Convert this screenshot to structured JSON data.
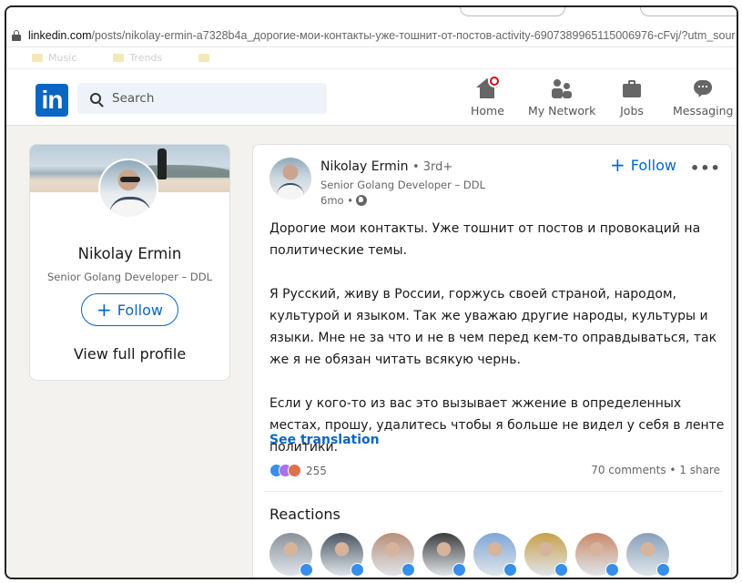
{
  "browser": {
    "url_host": "linkedin.com",
    "url_path": "/posts/nikolay-ermin-a7328b4a_дорогие-мои-контакты-уже-тошнит-от-постов-activity-6907389965115006976-cFvj/?utm_sour",
    "bookmarks": [
      {
        "label": "Music"
      },
      {
        "label": "Trends"
      },
      {
        "label": ""
      },
      {
        "label": ""
      }
    ]
  },
  "header": {
    "logo": "in",
    "search_placeholder": "Search",
    "nav": {
      "home": "Home",
      "network": "My Network",
      "jobs": "Jobs",
      "messaging": "Messaging"
    }
  },
  "profile_card": {
    "name": "Nikolay Ermin",
    "headline": "Senior Golang Developer – DDL",
    "follow_label": "Follow",
    "view_profile": "View full profile"
  },
  "post": {
    "author": "Nikolay Ermin",
    "degree": "• 3rd+",
    "headline": "Senior Golang Developer – DDL",
    "time": "6mo •",
    "follow_label": "Follow",
    "more": "•••",
    "paragraphs": [
      "Дорогие мои контакты. Уже тошнит от постов и провокаций на политические темы.",
      "Я Русский, живу в России, горжусь своей страной, народом, культурой и языком. Так же уважаю другие народы, культуры и языки. Мне не за что и не в чем перед кем-то оправдываться, так же я не обязан читать всякую чернь.",
      "Если у кого-то из вас это вызывает жжение в определенных местах, прошу, удалитесь чтобы я больше не видел у себя в ленте политики."
    ],
    "see_translation": "See translation",
    "reaction_count": "255",
    "comments_share": "70 comments • 1 share",
    "reactions_title": "Reactions",
    "reactor_colors": [
      "#8a9199",
      "#4a5563",
      "#b98f7a",
      "#3c3c3c",
      "#7fa6d6",
      "#c9a04a",
      "#c98a6a",
      "#8aa0b8"
    ]
  }
}
